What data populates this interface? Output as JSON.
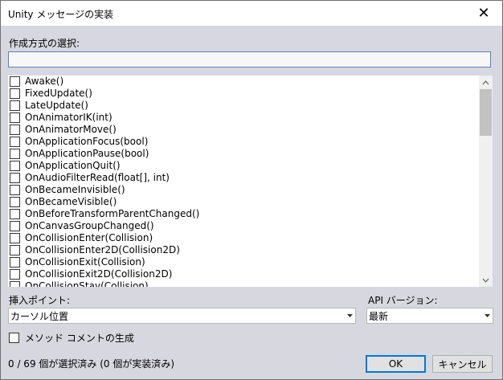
{
  "window": {
    "title": "Unity メッセージの実装",
    "close_glyph": "✕"
  },
  "method_selection": {
    "label": "作成方式の選択:",
    "search_value": ""
  },
  "methods": [
    "Awake()",
    "FixedUpdate()",
    "LateUpdate()",
    "OnAnimatorIK(int)",
    "OnAnimatorMove()",
    "OnApplicationFocus(bool)",
    "OnApplicationPause(bool)",
    "OnApplicationQuit()",
    "OnAudioFilterRead(float[], int)",
    "OnBecameInvisible()",
    "OnBecameVisible()",
    "OnBeforeTransformParentChanged()",
    "OnCanvasGroupChanged()",
    "OnCollisionEnter(Collision)",
    "OnCollisionEnter2D(Collision2D)",
    "OnCollisionExit(Collision)",
    "OnCollisionExit2D(Collision2D)",
    "OnCollisionStay(Collision)"
  ],
  "scroll_icons": {
    "up": "up-arrow-icon",
    "down": "down-arrow-icon"
  },
  "insertion_point": {
    "label": "挿入ポイント:",
    "value": "カーソル位置"
  },
  "api_version": {
    "label": "API バージョン:",
    "value": "最新"
  },
  "generate_comments": {
    "label": "メソッド コメントの生成",
    "checked": false
  },
  "status": {
    "text": "0 / 69 個が選択済み (0 個が実装済み)"
  },
  "buttons": {
    "ok": "OK",
    "cancel": "キャンセル"
  }
}
